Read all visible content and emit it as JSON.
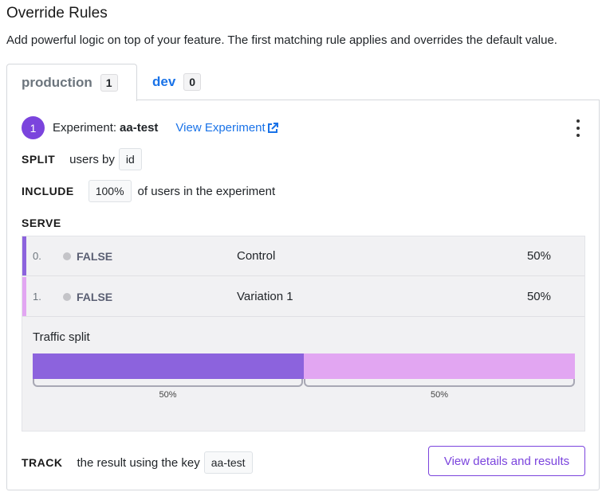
{
  "header": {
    "title": "Override Rules",
    "subtitle": "Add powerful logic on top of your feature. The first matching rule applies and overrides the default value."
  },
  "tabs": [
    {
      "label": "production",
      "count": "1",
      "active": true
    },
    {
      "label": "dev",
      "count": "0",
      "active": false
    }
  ],
  "rule": {
    "number": "1",
    "type_label": "Experiment:",
    "experiment_name": "aa-test",
    "view_link": "View Experiment",
    "split": {
      "keyword": "SPLIT",
      "text": "users by",
      "attribute": "id"
    },
    "include": {
      "keyword": "INCLUDE",
      "percent": "100%",
      "text": "of users in the experiment"
    },
    "serve": {
      "keyword": "SERVE",
      "variations": [
        {
          "index": "0.",
          "value": "FALSE",
          "name": "Control",
          "percent": "50%",
          "weight": 0.5,
          "color": "#8c63dd"
        },
        {
          "index": "1.",
          "value": "FALSE",
          "name": "Variation 1",
          "percent": "50%",
          "weight": 0.5,
          "color": "#e2a6f2"
        }
      ],
      "traffic_split_label": "Traffic split",
      "split_labels": [
        "50%",
        "50%"
      ]
    },
    "track": {
      "keyword": "TRACK",
      "text": "the result using the key",
      "key": "aa-test"
    },
    "details_button": "View details and results"
  },
  "icons": {
    "external_link": "external-link-icon",
    "menu": "kebab-menu-icon",
    "status_dot": "status-dot-icon"
  },
  "colors": {
    "accent": "#7b44dd",
    "link": "#1a73e8"
  }
}
